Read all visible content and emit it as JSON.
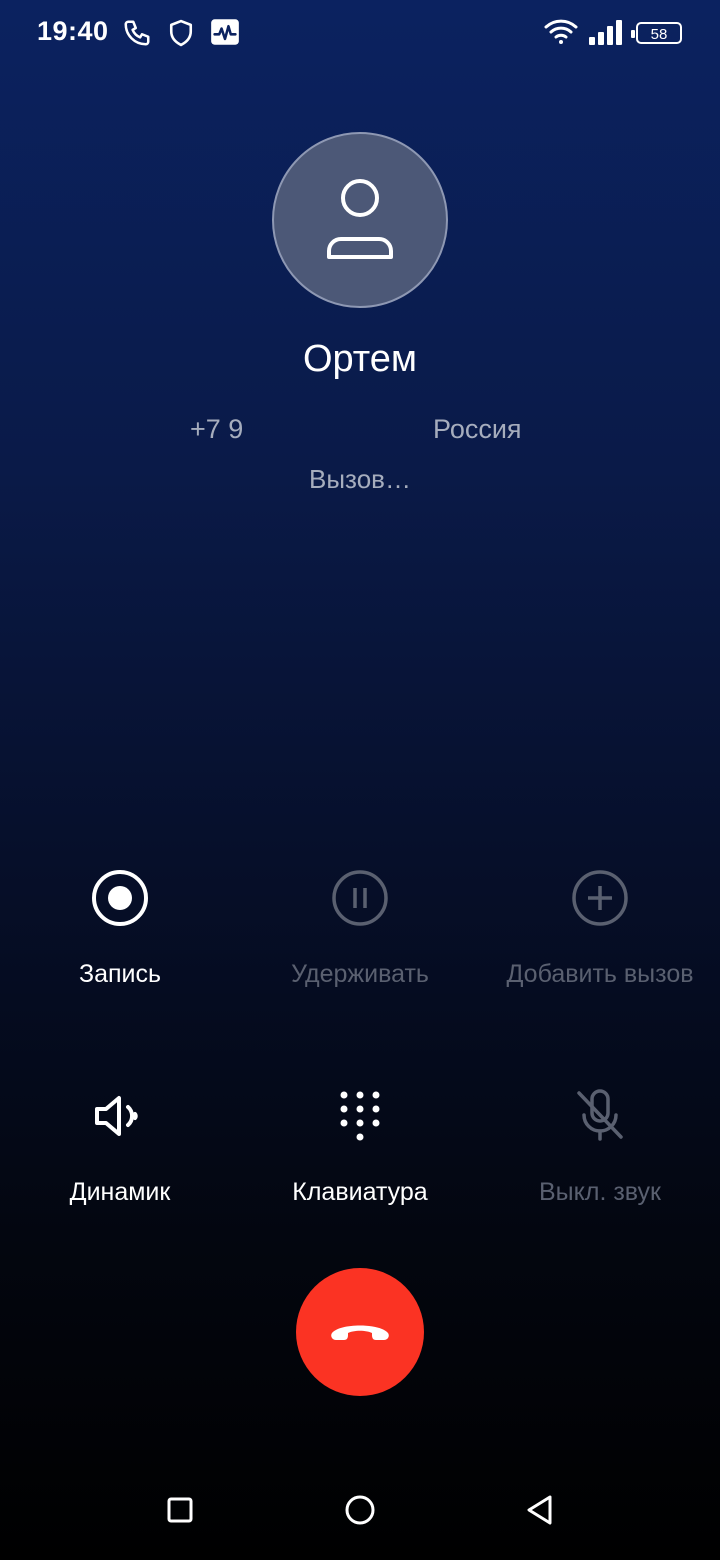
{
  "status_bar": {
    "time": "19:40",
    "icons": [
      "phone-icon",
      "shield-icon",
      "activity-icon",
      "wifi-icon",
      "signal-icon",
      "battery-icon"
    ],
    "battery_level": "58"
  },
  "contact": {
    "name": "Ортем",
    "phone": "+7 9",
    "region": "Россия",
    "status": "Вызов…"
  },
  "controls": [
    {
      "label": "Запись",
      "icon": "record-icon",
      "enabled": true
    },
    {
      "label": "Удерживать",
      "icon": "pause-icon",
      "enabled": false
    },
    {
      "label": "Добавить вызов",
      "icon": "add-call-icon",
      "enabled": false
    },
    {
      "label": "Динамик",
      "icon": "speaker-icon",
      "enabled": true
    },
    {
      "label": "Клавиатура",
      "icon": "keypad-icon",
      "enabled": true
    },
    {
      "label": "Выкл. звук",
      "icon": "mute-icon",
      "enabled": false
    }
  ],
  "end_call": {
    "icon": "end-call-icon",
    "color": "#fb3323"
  },
  "nav_bar": {
    "icons": [
      "recents-icon",
      "home-icon",
      "back-icon"
    ]
  }
}
